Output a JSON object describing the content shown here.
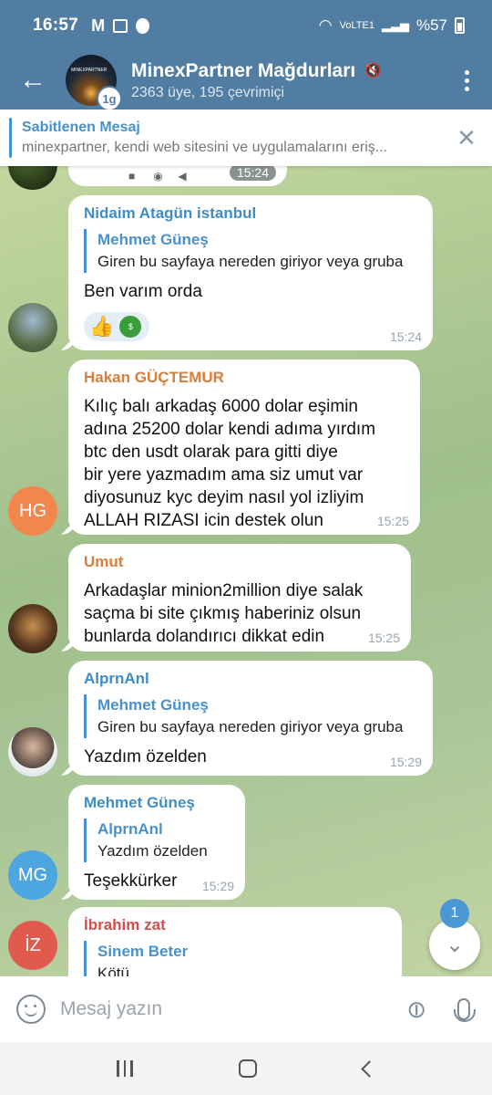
{
  "status_bar": {
    "time": "16:57",
    "network": "VoLTE1",
    "battery": "%57"
  },
  "header": {
    "title": "MinexPartner Mağdurları",
    "subtitle": "2363 üye, 195 çevrimiçi",
    "avatar_badge": "1g",
    "avatar_text": "MINEXPARTNER"
  },
  "pinned": {
    "title": "Sabitlenen Mesaj",
    "text": "minexpartner, kendi web sitesini ve uygulamalarını eriş..."
  },
  "top_partial": {
    "time": "15:24"
  },
  "messages": [
    {
      "sender": "Nidaim Atagün istanbul",
      "sender_color": "#3d8dc9",
      "reply_name": "Mehmet Güneş",
      "reply_text": "Giren bu sayfaya nereden giriyor veya gruba",
      "text": "Ben varım orda",
      "time": "15:24",
      "reaction": "👍",
      "reaction_avatar": "$"
    },
    {
      "sender": "Hakan GÜÇTEMUR",
      "sender_color": "#d87e3a",
      "avatar_initials": "HG",
      "avatar_color": "#f1874c",
      "text": "Kılıç balı arkadaş 6000 dolar eşimin\nadına 25200 dolar kendi adıma yırdım\nbtc den usdt olarak para gitti diye\nbir yere yazmadım ama siz umut var\ndiyosunuz  kyc deyim nasıl yol izliyim\nALLAH RIZASI icin destek olun",
      "time": "15:25"
    },
    {
      "sender": "Umut",
      "sender_color": "#d87e3a",
      "text": "Arkadaşlar minion2million diye salak\nsaçma bi site çıkmış haberiniz olsun\nbunlarda dolandırıcı dikkat edin",
      "time": "15:25"
    },
    {
      "sender": "AlprnAnl",
      "sender_color": "#3d8dc9",
      "reply_name": "Mehmet Güneş",
      "reply_text": "Giren bu sayfaya nereden giriyor veya gruba",
      "text": "Yazdım özelden",
      "time": "15:29"
    },
    {
      "sender": "Mehmet Güneş",
      "sender_color": "#3d8dc9",
      "avatar_initials": "MG",
      "avatar_color": "#4da6e0",
      "reply_name": "AlprnAnl",
      "reply_text": "Yazdım özelden",
      "text": "Teşekkürker",
      "time": "15:29"
    },
    {
      "sender": "İbrahim zat",
      "sender_color": "#d04e4e",
      "avatar_initials": "İZ",
      "avatar_color": "#e15a4e",
      "reply_name": "Sinem Beter",
      "reply_text": "Kötü"
    }
  ],
  "scroll_badge": "1",
  "composer": {
    "placeholder": "Mesaj yazın"
  }
}
